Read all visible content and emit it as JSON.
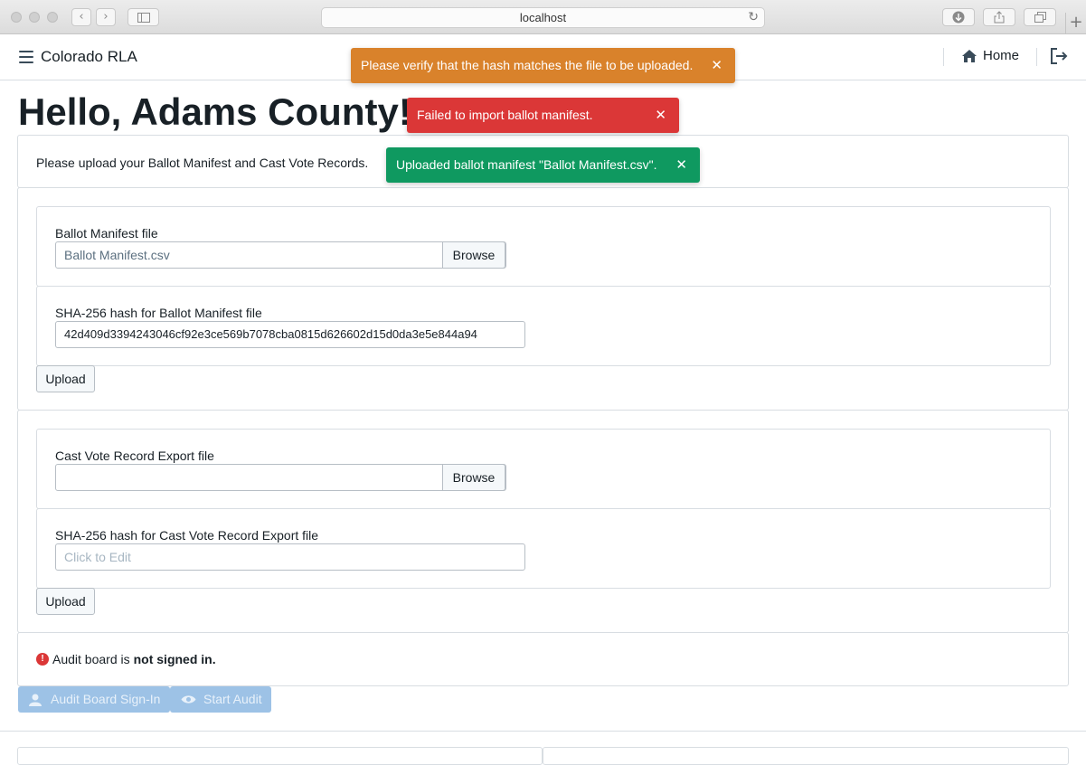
{
  "browser": {
    "url": "localhost",
    "newtab_glyph": "+"
  },
  "navbar": {
    "brand": "Colorado RLA",
    "home_label": "Home",
    "menu_icon": "menu-icon",
    "home_icon": "home-icon",
    "logout_icon": "logout-icon"
  },
  "page": {
    "title": "Hello, Adams County!",
    "intro": "Please upload your Ballot Manifest and Cast Vote Records."
  },
  "ballot_manifest": {
    "file_label": "Ballot Manifest file",
    "file_value": "Ballot Manifest.csv",
    "browse_label": "Browse",
    "hash_label": "SHA-256 hash for Ballot Manifest file",
    "hash_value": "42d409d3394243046cf92e3ce569b7078cba0815d626602d15d0da3e5e844a94",
    "upload_label": "Upload"
  },
  "cvr": {
    "file_label": "Cast Vote Record Export file",
    "file_value": "",
    "browse_label": "Browse",
    "hash_label": "SHA-256 hash for Cast Vote Record Export file",
    "hash_placeholder": "Click to Edit",
    "upload_label": "Upload"
  },
  "audit_status": {
    "icon": "alert-icon",
    "prefix": "Audit board is",
    "status": "not signed in."
  },
  "actions": {
    "sign_in_label": "Audit Board Sign-In",
    "start_audit_label": "Start Audit"
  },
  "toasts": [
    {
      "message": "Please verify that the hash matches the file to be uploaded.",
      "color": "#d9822b"
    },
    {
      "message": "Failed to import ballot manifest.",
      "color": "#db3737"
    },
    {
      "message": "Uploaded ballot manifest \"Ballot Manifest.csv\".",
      "color": "#0f9960"
    }
  ],
  "colors": {
    "warning": "#d9822b",
    "danger": "#db3737",
    "success": "#0f9960",
    "disabled_primary": "#9dc2e6"
  }
}
